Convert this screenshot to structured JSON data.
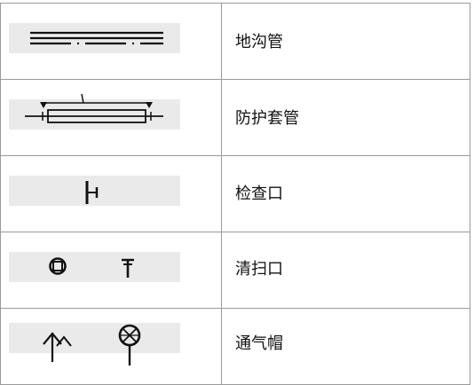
{
  "legend": {
    "rows": [
      {
        "label": "地沟管",
        "symbol": "trench-pipe-icon"
      },
      {
        "label": "防护套管",
        "symbol": "protective-sleeve-icon"
      },
      {
        "label": "检查口",
        "symbol": "inspection-port-icon"
      },
      {
        "label": "清扫口",
        "symbol": "cleanout-icon"
      },
      {
        "label": "通气帽",
        "symbol": "vent-cap-icon"
      }
    ]
  }
}
